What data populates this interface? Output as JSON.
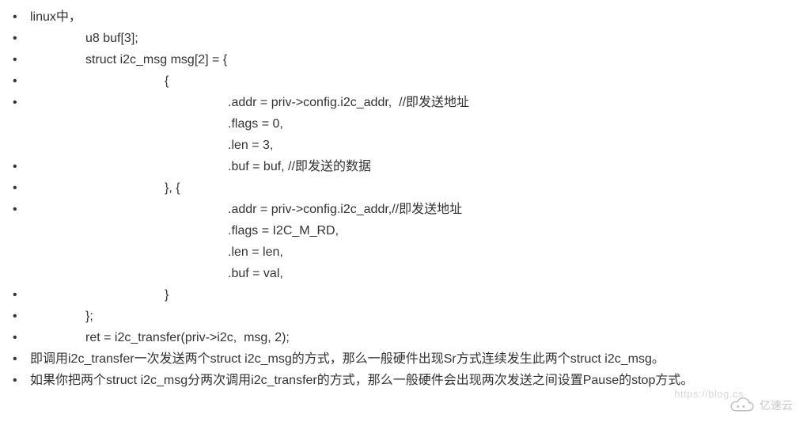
{
  "lines": {
    "l0": "linux中，",
    "l1": "u8 buf[3];",
    "l2": "struct i2c_msg msg[2] = {",
    "l3": "{",
    "l4": ".addr = priv->config.i2c_addr,  //即发送地址",
    "l5": ".flags = 0,",
    "l6": ".len = 3,",
    "l7": ".buf = buf, //即发送的数据",
    "l8": "}, {",
    "l9": ".addr = priv->config.i2c_addr,//即发送地址",
    "l10": ".flags = I2C_M_RD,",
    "l11": ".len = len,",
    "l12": ".buf = val,",
    "l13": "}",
    "l14": "};",
    "l15": "ret = i2c_transfer(priv->i2c,  msg, 2);",
    "l16": "即调用i2c_transfer一次发送两个struct  i2c_msg的方式，那么一般硬件出现Sr方式连续发生此两个struct i2c_msg。",
    "l17": "如果你把两个struct i2c_msg分两次调用i2c_transfer的方式，那么一般硬件会出现两次发送之间设置Pause的stop方式。"
  },
  "watermark": {
    "faint": "https://blog.cs",
    "brand": "亿速云"
  }
}
